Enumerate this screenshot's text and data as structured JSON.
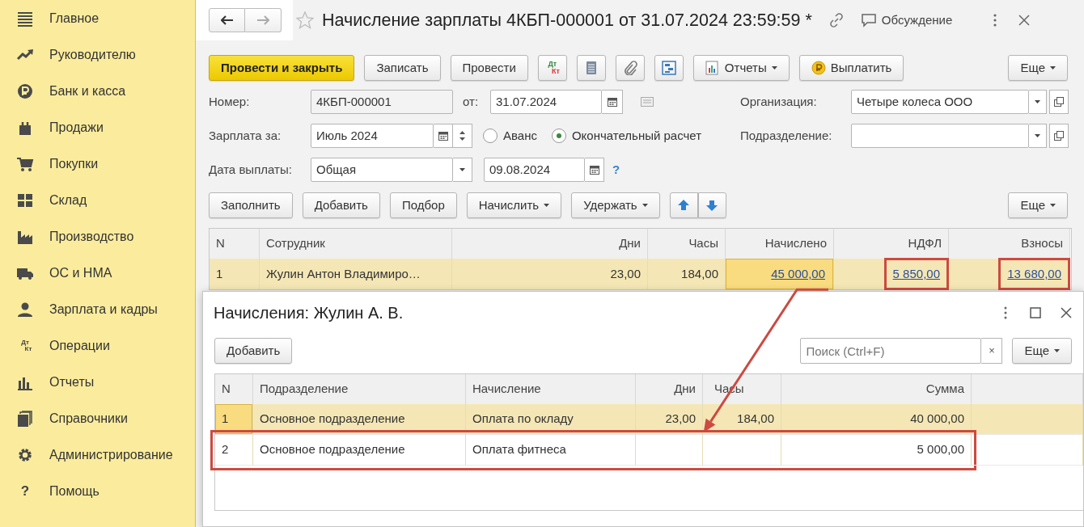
{
  "sidebar": {
    "items": [
      {
        "label": "Главное",
        "kind": "lines"
      },
      {
        "label": "Руководителю",
        "kind": "trend"
      },
      {
        "label": "Банк и касса",
        "kind": "coin"
      },
      {
        "label": "Продажи",
        "kind": "bag"
      },
      {
        "label": "Покупки",
        "kind": "cart"
      },
      {
        "label": "Склад",
        "kind": "grid"
      },
      {
        "label": "Производство",
        "kind": "factory"
      },
      {
        "label": "ОС и НМА",
        "kind": "truck"
      },
      {
        "label": "Зарплата и кадры",
        "kind": "person"
      },
      {
        "label": "Операции",
        "kind": "text",
        "icon_text": [
          "Дт",
          "Кт"
        ]
      },
      {
        "label": "Отчеты",
        "kind": "bars"
      },
      {
        "label": "Справочники",
        "kind": "books"
      },
      {
        "label": "Администрирование",
        "kind": "gear"
      },
      {
        "label": "Помощь",
        "kind": "text",
        "icon_text": [
          "?"
        ]
      }
    ]
  },
  "document": {
    "title": "Начисление зарплаты 4КБП-000001 от 31.07.2024 23:59:59 *",
    "discussion": "Обсуждение"
  },
  "toolbar": [
    {
      "kind": "primary",
      "label": "Провести и закрыть"
    },
    {
      "kind": "plain",
      "label": "Записать"
    },
    {
      "kind": "plain",
      "label": "Провести"
    },
    {
      "kind": "dtkt",
      "icon_text": [
        "Дт",
        "Кт"
      ]
    },
    {
      "kind": "list"
    },
    {
      "kind": "clip"
    },
    {
      "kind": "struct"
    },
    {
      "kind": "reports",
      "label": "Отчеты"
    },
    {
      "kind": "pay",
      "label": "Выплатить"
    },
    {
      "kind": "dropdown",
      "label": "Еще"
    }
  ],
  "fields": {
    "number_label": "Номер:",
    "number": "4КБП-000001",
    "date_label": "от:",
    "date": "31.07.2024",
    "org_label": "Организация:",
    "org": "Четыре колеса ООО",
    "period_label": "Зарплата за:",
    "period": "Июль 2024",
    "radios": [
      {
        "label": "Аванс",
        "selected": false
      },
      {
        "label": "Окончательный расчет",
        "selected": true
      }
    ],
    "division_label": "Подразделение:",
    "pay_label": "Дата выплаты:",
    "pay_type": "Общая",
    "pay_date": "09.08.2024",
    "help": "?"
  },
  "table_toolbar": [
    {
      "kind": "plain",
      "label": "Заполнить"
    },
    {
      "kind": "plain",
      "label": "Добавить"
    },
    {
      "kind": "plain",
      "label": "Подбор"
    },
    {
      "kind": "dropdown",
      "label": "Начислить"
    },
    {
      "kind": "dropdown",
      "label": "Удержать"
    },
    {
      "kind": "arrows"
    },
    {
      "kind": "dropdown",
      "label": "Еще"
    }
  ],
  "table": {
    "columns": [
      {
        "label": "N"
      },
      {
        "label": "Сотрудник"
      },
      {
        "label": "Дни"
      },
      {
        "label": "Часы"
      },
      {
        "label": "Начислено"
      },
      {
        "label": "НДФЛ"
      },
      {
        "label": "Взносы"
      }
    ],
    "rows": [
      {
        "selected": true,
        "cells": [
          {
            "text": "1"
          },
          {
            "text": "Жулин Антон Владимиро…"
          },
          {
            "text": "23,00"
          },
          {
            "text": "184,00"
          },
          {
            "text": "45 000,00",
            "focused": true
          },
          {
            "text": "5 850,00",
            "outlined": true
          },
          {
            "text": "13 680,00",
            "outlined": true
          }
        ]
      }
    ]
  },
  "popup": {
    "title": "Начисления: Жулин А. В.",
    "add": "Добавить",
    "search_placeholder": "Поиск (Ctrl+F)",
    "clear": "×",
    "more": "Еще",
    "columns": [
      {
        "label": "N"
      },
      {
        "label": "Подразделение"
      },
      {
        "label": "Начисление"
      },
      {
        "label": "Дни"
      },
      {
        "label": "Часы"
      },
      {
        "label": "Сумма"
      }
    ],
    "rows": [
      {
        "selected": true,
        "outlined": false,
        "cells": [
          {
            "text": "1",
            "focused": true
          },
          {
            "text": "Основное подразделение"
          },
          {
            "text": "Оплата по окладу"
          },
          {
            "text": "23,00"
          },
          {
            "text": "184,00"
          },
          {
            "text": "40 000,00"
          }
        ]
      },
      {
        "selected": false,
        "outlined": true,
        "cells": [
          {
            "text": "2",
            "focused": false
          },
          {
            "text": "Основное подразделение"
          },
          {
            "text": "Оплата фитнеса"
          },
          {
            "text": ""
          },
          {
            "text": ""
          },
          {
            "text": "5 000,00"
          }
        ]
      }
    ]
  }
}
